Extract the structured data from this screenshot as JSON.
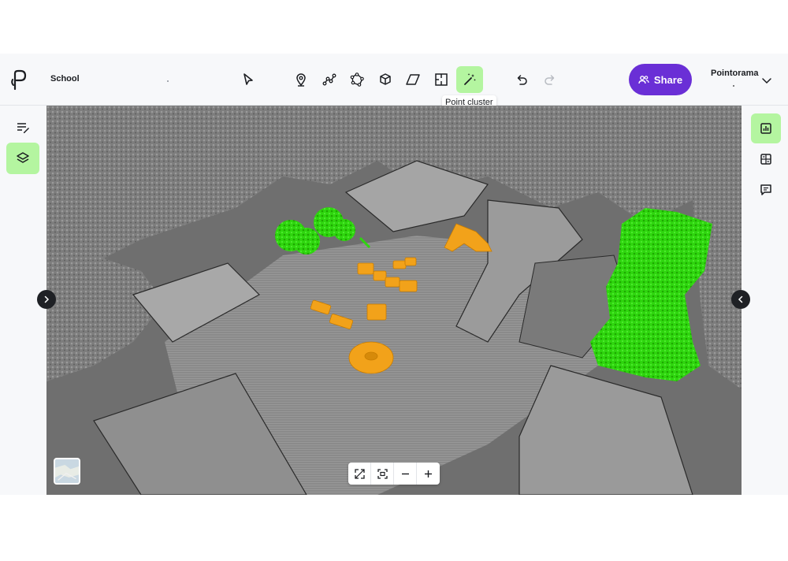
{
  "project": {
    "title": "School"
  },
  "toolbar": {
    "tools": [
      {
        "name": "select-tool",
        "icon": "cursor-arrow-icon"
      },
      {
        "name": "point-tool",
        "icon": "map-pin-icon"
      },
      {
        "name": "polyline-tool",
        "icon": "polyline-icon"
      },
      {
        "name": "polygon-tool",
        "icon": "polygon-icon"
      },
      {
        "name": "cuboid-tool",
        "icon": "cube-icon"
      },
      {
        "name": "plane-tool",
        "icon": "parallelogram-icon"
      },
      {
        "name": "room-tool",
        "icon": "floorplan-icon"
      },
      {
        "name": "point-cluster-tool",
        "icon": "magic-wand-icon"
      }
    ],
    "active_tool": "point-cluster-tool",
    "tooltip": "Point cluster",
    "undo_icon": "undo-icon",
    "redo_icon": "redo-icon"
  },
  "share": {
    "label": "Share",
    "icon": "users-icon"
  },
  "user": {
    "name": "Pointorama"
  },
  "left_rail": [
    {
      "name": "annotations-list",
      "icon": "list-edit-icon",
      "active": false
    },
    {
      "name": "layers",
      "icon": "layers-icon",
      "active": true
    }
  ],
  "right_rail": [
    {
      "name": "stats-panel",
      "icon": "bar-chart-icon",
      "active": true
    },
    {
      "name": "calculator-panel",
      "icon": "calculator-icon",
      "active": false
    },
    {
      "name": "comments-panel",
      "icon": "comment-icon",
      "active": false
    }
  ],
  "viewport": {
    "zoom_controls": [
      "fullscreen-icon",
      "fit-view-icon",
      "zoom-out-icon",
      "zoom-in-icon"
    ],
    "colors": {
      "background": "#6f6f6f",
      "cloud": "#8c8c8c",
      "cluster_green": "#2fd60f",
      "cluster_orange": "#f2a21a"
    }
  },
  "colors": {
    "accent": "#6a2fd6",
    "active": "#b4f5a0"
  }
}
